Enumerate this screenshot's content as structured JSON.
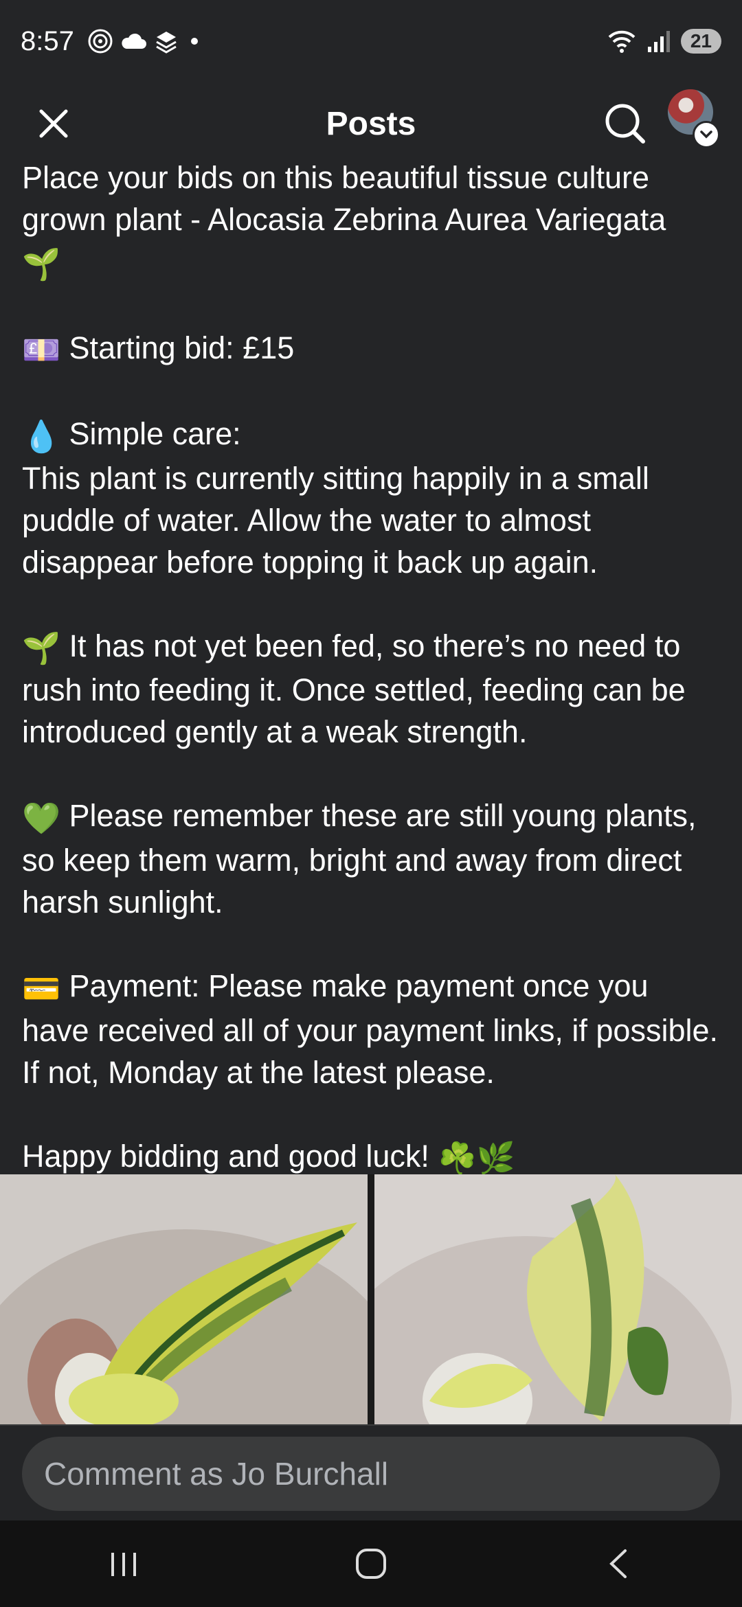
{
  "status_bar": {
    "time": "8:57",
    "battery": "21",
    "signal_label": "6"
  },
  "app_bar": {
    "title": "Posts"
  },
  "post": {
    "intro": "Place your bids on this beautiful tissue culture grown plant - Alocasia Zebrina Aurea Variegata",
    "intro_emoji": "🌱",
    "starting_bid": "Starting bid: £15",
    "starting_bid_emoji": "💷",
    "care_heading": "Simple care:",
    "care_emoji": "💧",
    "care_text": "This plant is currently sitting happily in a small puddle of water. Allow the water to almost disappear before topping it back up again.",
    "feed_emoji": "🌱",
    "feed_text": "It has not yet been fed, so there’s no need to rush into feeding it. Once settled, feeding can be introduced gently at a weak strength.",
    "warm_emoji": "💚",
    "warm_text": "Please remember these are still young plants, so keep them warm, bright and away from direct harsh sunlight.",
    "payment_emoji": "💳",
    "payment_text": "Payment: Please make payment once you have received all of your payment links, if possible. If not, Monday at the latest please.",
    "closing": "Happy bidding and good luck!",
    "closing_emoji": "☘️🌿"
  },
  "comment": {
    "placeholder": "Comment as Jo Burchall"
  },
  "icons": {
    "close": "close-icon",
    "search": "search-icon",
    "avatar": "avatar",
    "nav_recents": "recents-icon",
    "nav_home": "home-icon",
    "nav_back": "back-icon"
  },
  "colors": {
    "background": "#242527",
    "input_bg": "#3a3b3c",
    "nav_bg": "#121212"
  }
}
